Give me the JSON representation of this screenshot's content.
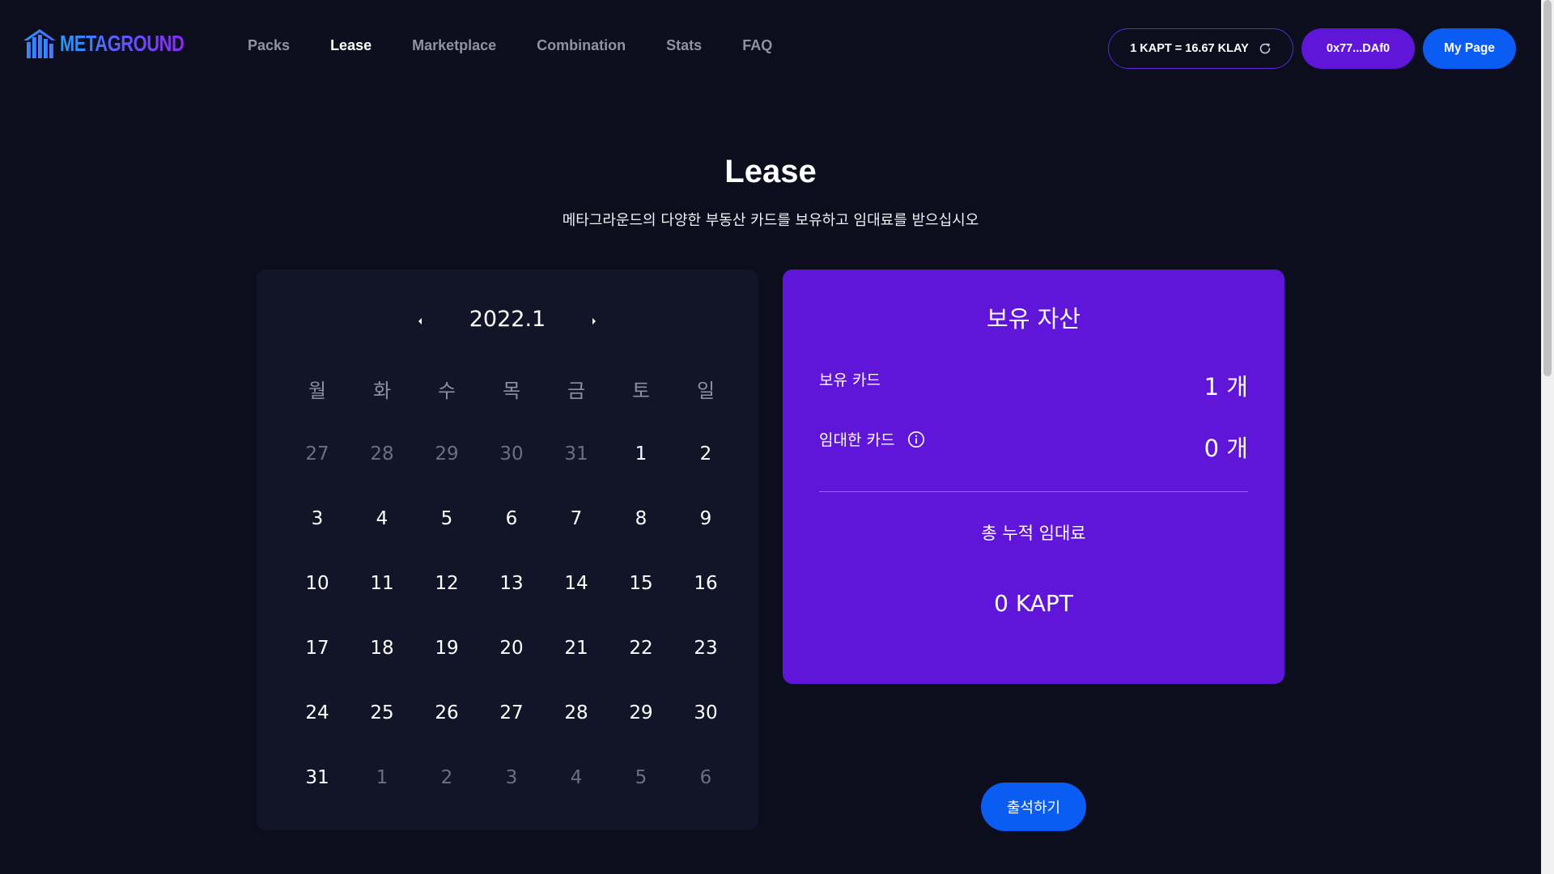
{
  "header": {
    "logo_text": "METAGROUND",
    "nav": [
      {
        "label": "Packs",
        "active": false
      },
      {
        "label": "Lease",
        "active": true
      },
      {
        "label": "Marketplace",
        "active": false
      },
      {
        "label": "Combination",
        "active": false
      },
      {
        "label": "Stats",
        "active": false
      },
      {
        "label": "FAQ",
        "active": false
      }
    ],
    "rate_text": "1 KAPT = 16.67 KLAY",
    "wallet_address": "0x77...DAf0",
    "my_page_label": "My Page"
  },
  "page": {
    "title": "Lease",
    "subtitle": "메타그라운드의 다양한 부동산 카드를 보유하고 임대료를 받으십시오"
  },
  "calendar": {
    "month_label": "2022.1",
    "weekdays": [
      "월",
      "화",
      "수",
      "목",
      "금",
      "토",
      "일"
    ],
    "weeks": [
      [
        "27",
        "28",
        "29",
        "30",
        "31",
        "1",
        "2"
      ],
      [
        "3",
        "4",
        "5",
        "6",
        "7",
        "8",
        "9"
      ],
      [
        "10",
        "11",
        "12",
        "13",
        "14",
        "15",
        "16"
      ],
      [
        "17",
        "18",
        "19",
        "20",
        "21",
        "22",
        "23"
      ],
      [
        "24",
        "25",
        "26",
        "27",
        "28",
        "29",
        "30"
      ],
      [
        "31",
        "1",
        "2",
        "3",
        "4",
        "5",
        "6"
      ]
    ],
    "muted": [
      [
        true,
        true,
        true,
        true,
        true,
        false,
        false
      ],
      [
        false,
        false,
        false,
        false,
        false,
        false,
        false
      ],
      [
        false,
        false,
        false,
        false,
        false,
        false,
        false
      ],
      [
        false,
        false,
        false,
        false,
        false,
        false,
        false
      ],
      [
        false,
        false,
        false,
        false,
        false,
        false,
        false
      ],
      [
        false,
        true,
        true,
        true,
        true,
        true,
        true
      ]
    ]
  },
  "assets": {
    "title": "보유 자산",
    "owned_cards_label": "보유 카드",
    "owned_cards_value": "1 개",
    "leased_cards_label": "임대한 카드",
    "leased_cards_value": "0 개",
    "total_rent_label": "총 누적 임대료",
    "total_rent_value": "0 KAPT"
  },
  "attend_button_label": "출석하기",
  "colors": {
    "background": "#0c0e1e",
    "calendar_bg": "#121527",
    "purple": "#5f16d8",
    "blue": "#0b5cf2"
  }
}
